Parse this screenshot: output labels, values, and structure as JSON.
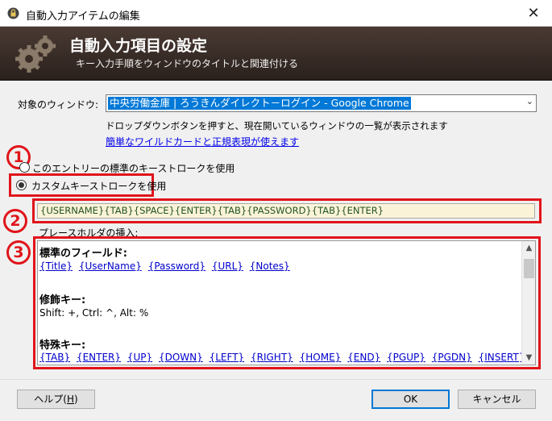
{
  "window": {
    "title": "自動入力アイテムの編集",
    "close_glyph": "✕"
  },
  "banner": {
    "title": "自動入力項目の設定",
    "subtitle": "キー入力手順をウィンドウのタイトルと関連付ける"
  },
  "target": {
    "label": "対象のウィンドウ:",
    "value": "中央労働金庫 | ろうきんダイレクト－ログイン - Google Chrome",
    "hint": "ドロップダウンボタンを押すと、現在開いているウィンドウの一覧が表示されます",
    "link": "簡単なワイルドカードと正規表現が使えます"
  },
  "keystroke": {
    "default_option": "このエントリーの標準のキーストロークを使用",
    "custom_option": "カスタムキーストロークを使用",
    "custom_selected": true,
    "value": "{USERNAME}{TAB}{SPACE}{ENTER}{TAB}{PASSWORD}{TAB}{ENTER}"
  },
  "markers": {
    "one": "1",
    "two": "2",
    "three": "3"
  },
  "placeholders": {
    "label": "プレースホルダの挿入:",
    "sections": [
      {
        "heading": "標準のフィールド:",
        "items": [
          "{Title}",
          "{UserName}",
          "{Password}",
          "{URL}",
          "{Notes}"
        ]
      },
      {
        "heading": "修飾キー:",
        "text": "Shift: +, Ctrl: ^, Alt: %"
      },
      {
        "heading": "特殊キー:",
        "items": [
          "{TAB}",
          "{ENTER}",
          "{UP}",
          "{DOWN}",
          "{LEFT}",
          "{RIGHT}",
          "{HOME}",
          "{END}",
          "{PGUP}",
          "{PGDN}",
          "{INSERT}"
        ]
      }
    ]
  },
  "buttons": {
    "help": "ヘルプ(",
    "help_key": "H",
    "help_end": ")",
    "ok": "OK",
    "cancel": "キャンセル"
  },
  "colors": {
    "highlight_red": "#e0141a",
    "selection_blue": "#0078d7",
    "banner_dark": "#2a211d"
  }
}
